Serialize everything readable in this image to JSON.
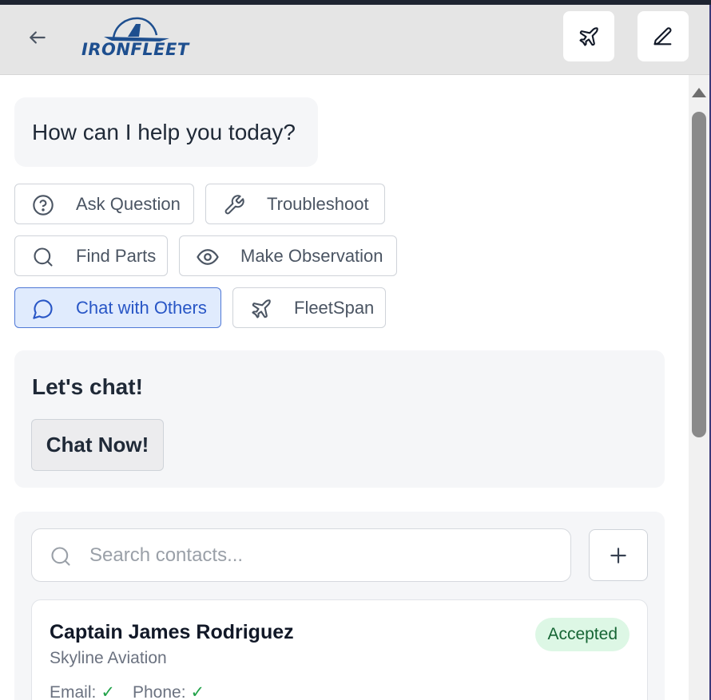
{
  "header": {
    "logo_text": "IRONFLEET",
    "back_icon": "arrow-left-icon",
    "plane_icon": "plane-icon",
    "edit_icon": "pencil-icon"
  },
  "greeting": "How can I help you today?",
  "chips": [
    {
      "label": "Ask Question",
      "icon": "question-circle-icon"
    },
    {
      "label": "Troubleshoot",
      "icon": "wrench-icon"
    },
    {
      "label": "Find Parts",
      "icon": "search-icon"
    },
    {
      "label": "Make Observation",
      "icon": "eye-icon"
    },
    {
      "label": "Chat with Others",
      "icon": "chat-bubble-icon",
      "active": true
    },
    {
      "label": "FleetSpan",
      "icon": "plane-icon"
    }
  ],
  "chat_panel": {
    "title": "Let's chat!",
    "button_label": "Chat Now!"
  },
  "contacts": {
    "search_placeholder": "Search contacts...",
    "add_button_symbol": "+",
    "items": [
      {
        "name": "Captain James Rodriguez",
        "organization": "Skyline Aviation",
        "status": "Accepted",
        "email_label": "Email:",
        "email_check": "✓",
        "phone_label": "Phone:",
        "phone_check": "✓"
      }
    ]
  },
  "colors": {
    "accent": "#2856c6",
    "active_chip_bg": "#e0ebfd",
    "logo": "#1e4f8f",
    "success": "#22a34a",
    "badge_bg": "#ddf7e5"
  }
}
